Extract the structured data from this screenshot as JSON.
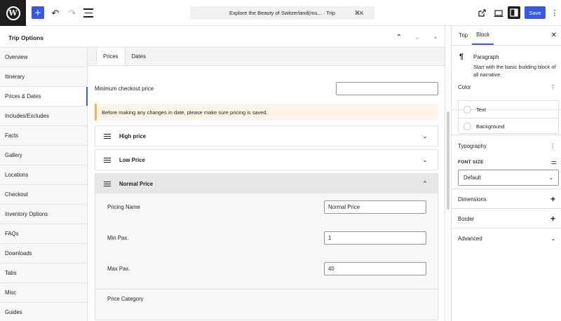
{
  "toolbar": {
    "logo_glyph": "W",
    "add_glyph": "+",
    "undo_glyph": "↶",
    "redo_glyph": "↷",
    "doc_title": "Explore the Beauty of Switzerland(mu... · Trip",
    "shortcut": "⌘K",
    "save_label": "Save",
    "more_glyph": "⋮"
  },
  "trip_options": {
    "title": "Trip Options",
    "up_glyph": "⌃",
    "down_glyph": "⌄",
    "tri_glyph": "▲",
    "nav": [
      {
        "label": "Overview"
      },
      {
        "label": "Itinerary"
      },
      {
        "label": "Prices & Dates",
        "active": true
      },
      {
        "label": "Includes/Excludes"
      },
      {
        "label": "Facts"
      },
      {
        "label": "Gallery"
      },
      {
        "label": "Locations"
      },
      {
        "label": "Checkout"
      },
      {
        "label": "Inventory Options"
      },
      {
        "label": "FAQs"
      },
      {
        "label": "Downloads"
      },
      {
        "label": "Tabs"
      },
      {
        "label": "Misc"
      },
      {
        "label": "Guides"
      }
    ],
    "tabs": [
      {
        "label": "Prices",
        "active": true
      },
      {
        "label": "Dates"
      }
    ],
    "min_checkout_label": "Minimum checkout price",
    "min_checkout_value": "",
    "notice": "Before making any changes in date, please make sure pricing is saved.",
    "pricings": [
      {
        "name": "High price",
        "chevron": "⌄"
      },
      {
        "name": "Low Price",
        "chevron": "⌄"
      },
      {
        "name": "Normal Price",
        "chevron": "⌃"
      }
    ],
    "normal_price": {
      "pricing_name_label": "Pricing Name",
      "pricing_name_value": "Normal Price",
      "min_pax_label": "Min Pax.",
      "min_pax_value": "1",
      "max_pax_label": "Max Pax.",
      "max_pax_value": "40",
      "category_label": "Price Category"
    }
  },
  "sidebar": {
    "tabs": [
      {
        "label": "Trip"
      },
      {
        "label": "Block",
        "active": true
      }
    ],
    "close_glyph": "✕",
    "block": {
      "glyph": "¶",
      "name": "Paragraph",
      "description": "Start with the basic building block of all narrative."
    },
    "color": {
      "title": "Color",
      "items": [
        "Text",
        "Background"
      ]
    },
    "typography": {
      "title": "Typography",
      "font_size_label": "FONT SIZE",
      "font_size_value": "Default",
      "settings_glyph": "⚌",
      "select_glyph": "⌄"
    },
    "dimensions": {
      "title": "Dimensions",
      "glyph": "+"
    },
    "border": {
      "title": "Border",
      "glyph": "+"
    },
    "advanced": {
      "title": "Advanced",
      "glyph": "⌄"
    },
    "menu_glyph": "⋮"
  }
}
